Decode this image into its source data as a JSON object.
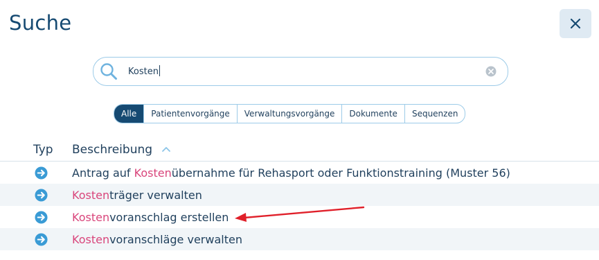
{
  "dialog": {
    "title": "Suche"
  },
  "search": {
    "query": "Kosten"
  },
  "tabs": [
    {
      "label": "Alle",
      "active": true
    },
    {
      "label": "Patientenvorgänge",
      "active": false
    },
    {
      "label": "Verwaltungsvorgänge",
      "active": false
    },
    {
      "label": "Dokumente",
      "active": false
    },
    {
      "label": "Sequenzen",
      "active": false
    }
  ],
  "table": {
    "headers": {
      "type": "Typ",
      "description": "Beschreibung"
    },
    "rows": [
      {
        "highlight": "Kosten",
        "rest": "übernahme für Rehasport oder Funktionstraining (Muster 56)",
        "prefix": "Antrag auf "
      },
      {
        "highlight": "Kosten",
        "rest": "träger verwalten",
        "prefix": ""
      },
      {
        "highlight": "Kosten",
        "rest": "voranschlag erstellen",
        "prefix": ""
      },
      {
        "highlight": "Kosten",
        "rest": "voranschläge verwalten",
        "prefix": ""
      }
    ]
  },
  "colors": {
    "accent": "#164a72",
    "highlight": "#d9457b",
    "icon": "#3a9bd5",
    "annotation_arrow": "#e0202a"
  }
}
